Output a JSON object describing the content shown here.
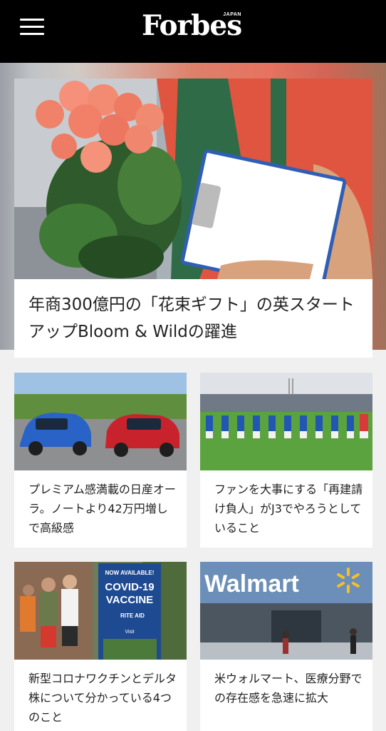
{
  "header": {
    "menu_icon": "hamburger-menu-icon",
    "logo_text": "Forbes",
    "logo_sub": "JAPAN"
  },
  "hero": {
    "title": "年商300億円の「花束ギフト」の英スタートアップBloom & Wildの躍進"
  },
  "articles": [
    {
      "title": "プレミアム感満載の日産オーラ。ノートより42万円増しで高級感"
    },
    {
      "title": "ファンを大事にする「再建請け負人」がJ3でやろうとしていること"
    },
    {
      "title": "新型コロナワクチンとデルタ株について分かっている4つのこと",
      "sign_line1": "NOW AVAILABLE!",
      "sign_line2": "COVID-19",
      "sign_line3": "VACCINE",
      "sign_brand": "RITE AID",
      "sign_visit": "Visit"
    },
    {
      "title": "米ウォルマート、医療分野での存在感を急速に拡大",
      "store_sign": "Walmart"
    }
  ],
  "colors": {
    "header_bg": "#000000",
    "page_bg": "#f0f0f0",
    "card_bg": "#ffffff",
    "text": "#222222"
  }
}
